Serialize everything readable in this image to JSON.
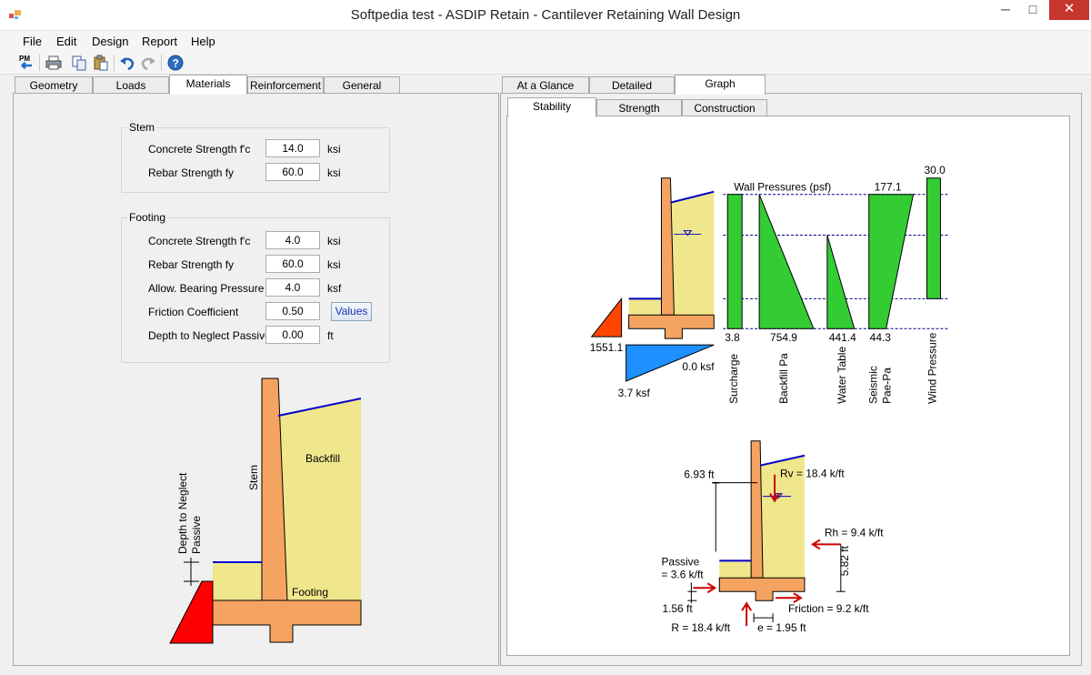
{
  "window": {
    "title": "Softpedia test - ASDIP Retain - Cantilever Retaining Wall Design",
    "minimize_glyph": "─",
    "maximize_glyph": "□",
    "close_glyph": "✕"
  },
  "menu": [
    "File",
    "Edit",
    "Design",
    "Report",
    "Help"
  ],
  "toolbar": {
    "pm_label": "PM",
    "icons": [
      "pm-icon",
      "print-icon",
      "copy-icon",
      "paste-icon",
      "undo-icon",
      "redo-icon",
      "help-icon"
    ]
  },
  "left_tabs": [
    "Geometry",
    "Loads",
    "Materials",
    "Reinforcement",
    "General"
  ],
  "left_active_tab": "Materials",
  "right_tabs": [
    "At a Glance",
    "Detailed",
    "Graph"
  ],
  "right_active_tab": "Graph",
  "sub_tabs": [
    "Stability",
    "Strength",
    "Construction"
  ],
  "sub_active_tab": "Stability",
  "stem": {
    "title": "Stem",
    "fields": [
      {
        "label": "Concrete Strength  f'c",
        "value": "14.0",
        "unit": "ksi"
      },
      {
        "label": "Rebar Strength  fy",
        "value": "60.0",
        "unit": "ksi"
      }
    ]
  },
  "footing": {
    "title": "Footing",
    "fields": [
      {
        "label": "Concrete Strength  f'c",
        "value": "4.0",
        "unit": "ksi"
      },
      {
        "label": "Rebar Strength  fy",
        "value": "60.0",
        "unit": "ksi"
      },
      {
        "label": "Allow. Bearing Pressure",
        "value": "4.0",
        "unit": "ksf"
      },
      {
        "label": "Friction Coefficient",
        "value": "0.50",
        "unit": ""
      },
      {
        "label": "Depth to Neglect Passive",
        "value": "0.00",
        "unit": "ft"
      }
    ],
    "values_button": "Values"
  },
  "left_diagram": {
    "backfill": "Backfill",
    "stem": "Stem",
    "footing": "Footing",
    "depth_label_1": "Depth to Neglect",
    "depth_label_2": "Passive"
  },
  "stability_graph": {
    "wall_pressures_title": "Wall Pressures (psf)",
    "passive_value": "1551.1",
    "soil_pressure_left": "3.7 ksf",
    "soil_pressure_right": "0.0 ksf",
    "bars": [
      {
        "name": "Surcharge",
        "value": "3.8"
      },
      {
        "name": "Backfill Pa",
        "value": "754.9"
      },
      {
        "name": "Water Table",
        "value": "441.4"
      },
      {
        "name": "Seismic Pae-Pa",
        "value": "44.3",
        "top_value": "177.1",
        "label_line1": "Seismic",
        "label_line2": "Pae-Pa"
      },
      {
        "name": "Wind Pressure",
        "top_value": "30.0"
      }
    ],
    "fill_color": "#33cc33",
    "concrete_color": "#f4a460",
    "soil_color": "#f0e68c",
    "passive_color": "#ff4500",
    "bearing_color": "#1e90ff"
  },
  "forces": {
    "rv": "Rv = 18.4 k/ft",
    "rh": "Rh = 9.4 k/ft",
    "passive_line1": "Passive",
    "passive_line2": "= 3.6 k/ft",
    "friction": "Friction = 9.2 k/ft",
    "r": "R = 18.4 k/ft",
    "e": "e = 1.95 ft",
    "dim_693": "6.93 ft",
    "dim_582": "5.82 ft",
    "dim_156": "1.56 ft"
  }
}
